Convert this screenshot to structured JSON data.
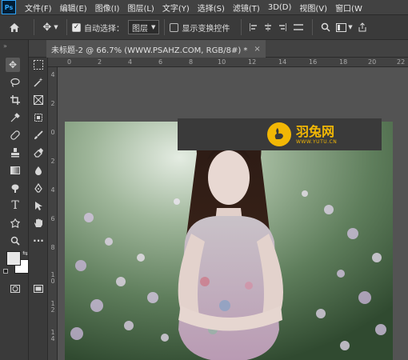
{
  "menubar": {
    "logo": "Ps",
    "items": [
      "文件(F)",
      "编辑(E)",
      "图像(I)",
      "图层(L)",
      "文字(Y)",
      "选择(S)",
      "滤镜(T)",
      "3D(D)",
      "视图(V)",
      "窗口(W"
    ]
  },
  "options": {
    "auto_select_label": "自动选择：",
    "layer_select_value": "图层",
    "show_transform_label": "显示变换控件"
  },
  "document": {
    "tab_title": "未标题-2 @ 66.7% (WWW.PSAHZ.COM, RGB/8#) *",
    "close_glyph": "×"
  },
  "rulers": {
    "horizontal": [
      "0",
      "2",
      "4",
      "6",
      "8",
      "10",
      "12",
      "14",
      "16",
      "18",
      "20",
      "22"
    ],
    "vertical": [
      "4",
      "2",
      "0",
      "2",
      "4",
      "6",
      "8",
      "1 0",
      "1 2",
      "1 4"
    ]
  },
  "watermark": {
    "title": "羽兔网",
    "url": "WWW.YUTU.CN"
  },
  "colors": {
    "foreground": "#e8e8e8",
    "background": "#ffffff",
    "brand": "#f2b705"
  }
}
